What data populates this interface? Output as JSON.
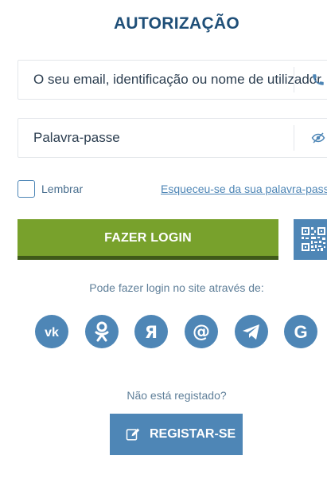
{
  "header": {
    "title": "AUTORIZAÇÃO"
  },
  "login_field": {
    "placeholder": "O seu email, identificação ou nome de utilizador",
    "icon": "phone-icon"
  },
  "password_field": {
    "placeholder": "Palavra-passe",
    "icon": "eye-slash-icon"
  },
  "remember": {
    "label": "Lembrar",
    "checked": false
  },
  "forgot_link": "Esqueceu-se da sua palavra-passe?",
  "login_button": "FAZER LOGIN",
  "qr_button_icon": "qr-code-icon",
  "social": {
    "caption": "Pode fazer login no site através de:",
    "providers": [
      "vk-icon",
      "odnoklassniki-icon",
      "yandex-icon",
      "mail-ru-icon",
      "telegram-icon",
      "google-icon"
    ]
  },
  "register": {
    "caption": "Não está registado?",
    "button": "REGISTAR-SE"
  },
  "colors": {
    "title": "#1f4f78",
    "accent_blue": "#4e86b6",
    "login_green": "#78a12c",
    "login_green_dark": "#3f5a19"
  }
}
